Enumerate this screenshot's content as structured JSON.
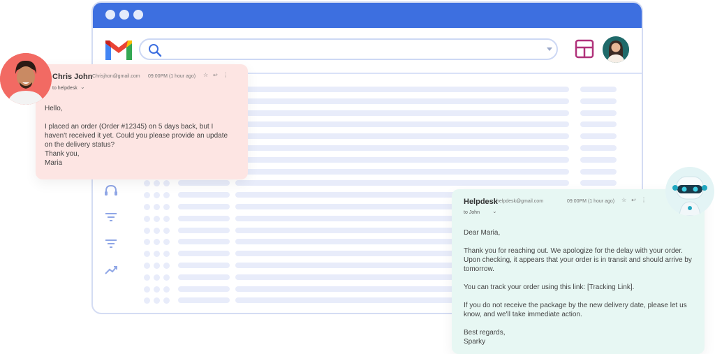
{
  "colors": {
    "accent": "#3d6fe0",
    "left_card": "#fde5e3",
    "right_card": "#e7f7f3"
  },
  "toolbar": {
    "search_value": "",
    "logo": "gmail-logo-icon",
    "layout": "layout-icon"
  },
  "sidebar": {
    "icons": [
      "headset-icon",
      "filter-icon",
      "filter-icon",
      "trending-icon"
    ]
  },
  "incoming_email": {
    "sender": "Chris John",
    "address": "Chrisjhon@gmail.com",
    "time": "09:00PM (1 hour ago)",
    "to": "to helpdesk",
    "body": "Hello,\n\nI placed an order (Order #12345) on 5 days back, but I\nhaven't received it yet. Could you please provide an update\non the delivery status?\nThank you,\nMaria"
  },
  "reply_email": {
    "sender": "Helpdesk",
    "address": "helpdesk@gmail.com",
    "time": "09:00PM (1 hour ago)",
    "to": "to John",
    "body": "Dear Maria,\n\nThank you for reaching out. We apologize for the delay with your order.\nUpon checking, it appears that your order is in transit and should arrive by\ntomorrow.\n\nYou can track your order using this link: [Tracking Link].\n\nIf you do not receive the package by the new delivery date, please let us\nknow, and we'll take immediate action.\n\nBest regards,\nSparky"
  }
}
